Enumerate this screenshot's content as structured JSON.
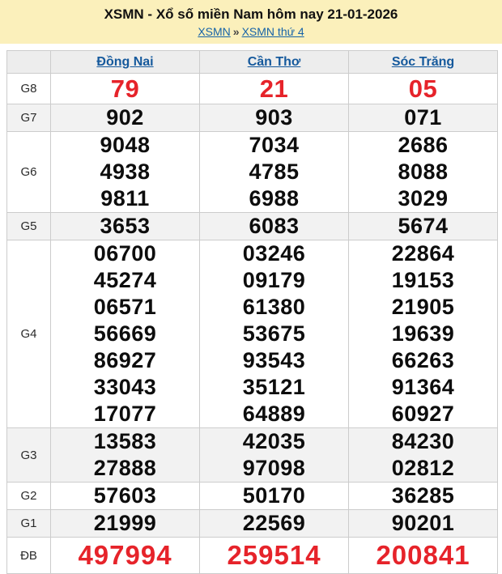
{
  "colors": {
    "banner_bg": "#FBF0BB",
    "link_blue": "#15599C",
    "accent_red": "#E6232A",
    "row_shaded": "#F2F2F2",
    "header_row_bg": "#EDEDED",
    "border": "#CCCCCC"
  },
  "header": {
    "title": "XSMN - Xổ số miền Nam hôm nay 21-01-2026",
    "breadcrumb": {
      "link1": "XSMN",
      "sep": "»",
      "link2": "XSMN thứ 4"
    }
  },
  "table": {
    "columns": [
      "Đồng Nai",
      "Cần Thơ",
      "Sóc Trăng"
    ],
    "rows": [
      {
        "prize": "G8",
        "cells": [
          [
            "79"
          ],
          [
            "21"
          ],
          [
            "05"
          ]
        ]
      },
      {
        "prize": "G7",
        "cells": [
          [
            "902"
          ],
          [
            "903"
          ],
          [
            "071"
          ]
        ]
      },
      {
        "prize": "G6",
        "cells": [
          [
            "9048",
            "4938",
            "9811"
          ],
          [
            "7034",
            "4785",
            "6988"
          ],
          [
            "2686",
            "8088",
            "3029"
          ]
        ]
      },
      {
        "prize": "G5",
        "cells": [
          [
            "3653"
          ],
          [
            "6083"
          ],
          [
            "5674"
          ]
        ]
      },
      {
        "prize": "G4",
        "cells": [
          [
            "06700",
            "45274",
            "06571",
            "56669",
            "86927",
            "33043",
            "17077"
          ],
          [
            "03246",
            "09179",
            "61380",
            "53675",
            "93543",
            "35121",
            "64889"
          ],
          [
            "22864",
            "19153",
            "21905",
            "19639",
            "66263",
            "91364",
            "60927"
          ]
        ]
      },
      {
        "prize": "G3",
        "cells": [
          [
            "13583",
            "27888"
          ],
          [
            "42035",
            "97098"
          ],
          [
            "84230",
            "02812"
          ]
        ]
      },
      {
        "prize": "G2",
        "cells": [
          [
            "57603"
          ],
          [
            "50170"
          ],
          [
            "36285"
          ]
        ]
      },
      {
        "prize": "G1",
        "cells": [
          [
            "21999"
          ],
          [
            "22569"
          ],
          [
            "90201"
          ]
        ]
      },
      {
        "prize": "ĐB",
        "cells": [
          [
            "497994"
          ],
          [
            "259514"
          ],
          [
            "200841"
          ]
        ]
      }
    ]
  }
}
